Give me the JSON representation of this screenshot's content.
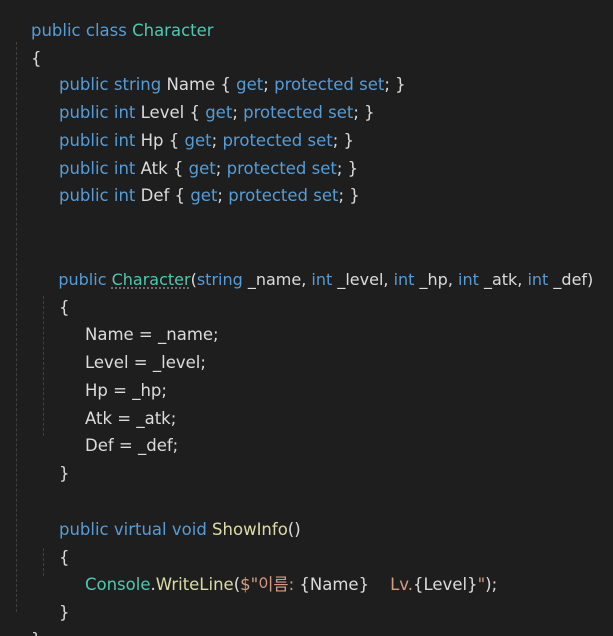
{
  "code": {
    "l0": {
      "kw": "public class ",
      "cls": "Character"
    },
    "l1": {
      "t": "{"
    },
    "l2": {
      "kw1": "public string ",
      "name": "Name",
      "p1": " { ",
      "kw2": "get",
      "p2": "; ",
      "kw3": "protected set",
      "p3": "; }"
    },
    "l3": {
      "kw1": "public int ",
      "name": "Level",
      "p1": " { ",
      "kw2": "get",
      "p2": "; ",
      "kw3": "protected set",
      "p3": "; }"
    },
    "l4": {
      "kw1": "public int ",
      "name": "Hp",
      "p1": " { ",
      "kw2": "get",
      "p2": "; ",
      "kw3": "protected set",
      "p3": "; }"
    },
    "l5": {
      "kw1": "public int ",
      "name": "Atk",
      "p1": " { ",
      "kw2": "get",
      "p2": "; ",
      "kw3": "protected set",
      "p3": "; }"
    },
    "l6": {
      "kw1": "public int ",
      "name": "Def",
      "p1": " { ",
      "kw2": "get",
      "p2": "; ",
      "kw3": "protected set",
      "p3": "; }"
    },
    "ctor": {
      "kw": "public ",
      "name": "Character",
      "p0": "(",
      "t1": "string",
      "a1": " _name",
      "c1": ", ",
      "t2": "int",
      "a2": " _level",
      "c2": ", ",
      "t3": "int",
      "a3": " _hp",
      "c3": ", ",
      "t4": "int",
      "a4": " _atk",
      "c4": ", ",
      "t5": "int",
      "a5": " _def",
      "p1": ")"
    },
    "ctor_open": "{",
    "assign": [
      {
        "lhs": "Name",
        "op": " = ",
        "rhs": "_name",
        "end": ";"
      },
      {
        "lhs": "Level",
        "op": " = ",
        "rhs": "_level",
        "end": ";"
      },
      {
        "lhs": "Hp",
        "op": " = ",
        "rhs": "_hp",
        "end": ";"
      },
      {
        "lhs": "Atk",
        "op": " = ",
        "rhs": "_atk",
        "end": ";"
      },
      {
        "lhs": "Def",
        "op": " = ",
        "rhs": "_def",
        "end": ";"
      }
    ],
    "ctor_close": "}",
    "method": {
      "kw": "public virtual void ",
      "name": "ShowInfo",
      "p": "()"
    },
    "method_open": "{",
    "call": {
      "cls": "Console",
      "dot": ".",
      "fn": "WriteLine",
      "p0": "(",
      "str1": "$\"이름: ",
      "interp1": "{Name}",
      "str2": "    Lv.",
      "interp2": "{Level}",
      "str3": "\"",
      "p1": ");"
    },
    "method_close": "}",
    "class_close": "}"
  },
  "colors": {
    "background": "#1e1e1e",
    "keyword": "#569cd6",
    "type": "#4ec9b0",
    "method": "#dcdcaa",
    "string": "#d69d85",
    "text": "#dcdcdc"
  }
}
